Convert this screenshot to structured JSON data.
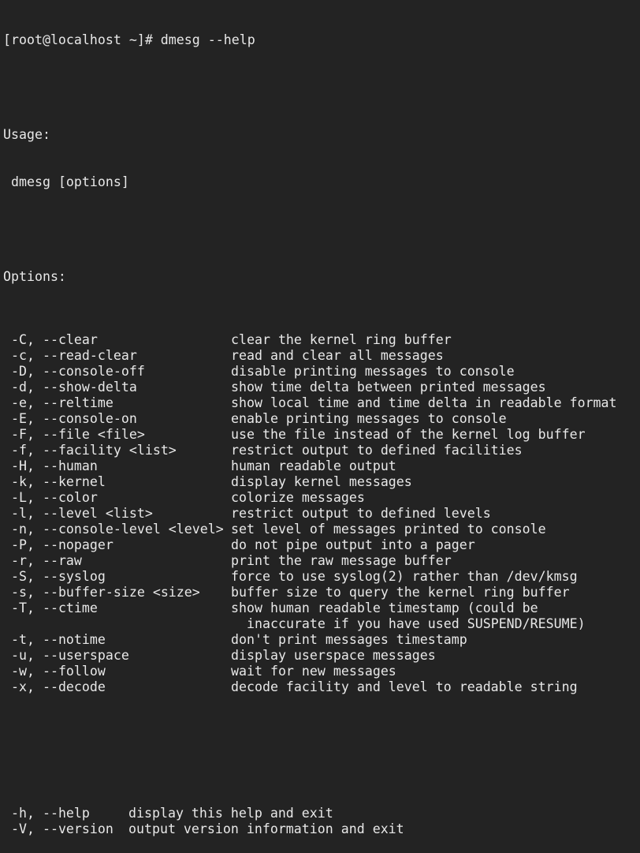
{
  "prompt": "[root@localhost ~]# dmesg --help",
  "usage_heading": "Usage:",
  "usage_line": "dmesg [options]",
  "options_heading": "Options:",
  "options": [
    {
      "flag": "-C, --clear",
      "desc": "clear the kernel ring buffer"
    },
    {
      "flag": "-c, --read-clear",
      "desc": "read and clear all messages"
    },
    {
      "flag": "-D, --console-off",
      "desc": "disable printing messages to console"
    },
    {
      "flag": "-d, --show-delta",
      "desc": "show time delta between printed messages"
    },
    {
      "flag": "-e, --reltime",
      "desc": "show local time and time delta in readable format"
    },
    {
      "flag": "-E, --console-on",
      "desc": "enable printing messages to console"
    },
    {
      "flag": "-F, --file <file>",
      "desc": "use the file instead of the kernel log buffer"
    },
    {
      "flag": "-f, --facility <list>",
      "desc": "restrict output to defined facilities"
    },
    {
      "flag": "-H, --human",
      "desc": "human readable output"
    },
    {
      "flag": "-k, --kernel",
      "desc": "display kernel messages"
    },
    {
      "flag": "-L, --color",
      "desc": "colorize messages"
    },
    {
      "flag": "-l, --level <list>",
      "desc": "restrict output to defined levels"
    },
    {
      "flag": "-n, --console-level <level>",
      "desc": "set level of messages printed to console"
    },
    {
      "flag": "-P, --nopager",
      "desc": "do not pipe output into a pager"
    },
    {
      "flag": "-r, --raw",
      "desc": "print the raw message buffer"
    },
    {
      "flag": "-S, --syslog",
      "desc": "force to use syslog(2) rather than /dev/kmsg"
    },
    {
      "flag": "-s, --buffer-size <size>",
      "desc": "buffer size to query the kernel ring buffer"
    },
    {
      "flag": "-T, --ctime",
      "desc": "show human readable timestamp (could be",
      "cont": "inaccurate if you have used SUSPEND/RESUME)"
    },
    {
      "flag": "-t, --notime",
      "desc": "don't print messages timestamp"
    },
    {
      "flag": "-u, --userspace",
      "desc": "display userspace messages"
    },
    {
      "flag": "-w, --follow",
      "desc": "wait for new messages"
    },
    {
      "flag": "-x, --decode",
      "desc": "decode facility and level to readable string"
    }
  ],
  "general_options": [
    {
      "flag": "-h, --help",
      "desc": "display this help and exit"
    },
    {
      "flag": "-V, --version",
      "desc": "output version information and exit"
    }
  ]
}
